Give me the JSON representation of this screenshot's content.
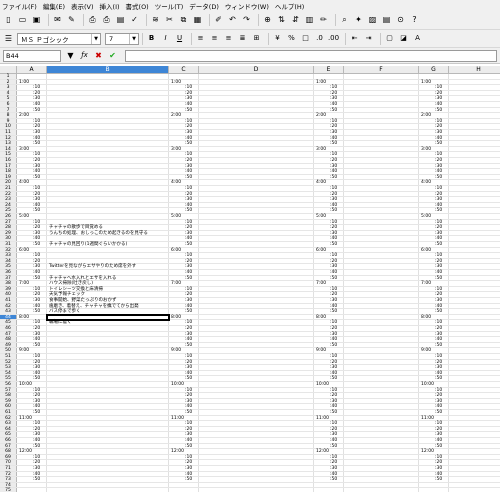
{
  "menu": [
    "ファイル(F)",
    "編集(E)",
    "表示(V)",
    "挿入(I)",
    "書式(O)",
    "ツール(T)",
    "データ(D)",
    "ウィンドウ(W)",
    "ヘルプ(H)"
  ],
  "toolbar1": [
    "new-document-icon",
    "open-icon",
    "save-icon",
    "email-icon",
    "edit-file-icon",
    "export-pdf-icon",
    "print-icon",
    "print-preview-icon",
    "spellcheck-icon",
    "autospell-icon",
    "cut-icon",
    "copy-icon",
    "paste-icon",
    "clone-format-icon",
    "undo-icon",
    "redo-icon",
    "hyperlink-icon",
    "sort-ascending-icon",
    "sort-descending-icon",
    "chart-icon",
    "draw-functions-icon",
    "find-icon",
    "navigator-icon",
    "gallery-icon",
    "data-sources-icon",
    "zoom-icon",
    "help-icon"
  ],
  "toolbar2": {
    "font_name": "ＭＳ Ｐゴシック",
    "font_size": "7",
    "buttons": [
      "bold-icon",
      "italic-icon",
      "underline-icon",
      "align-left-icon",
      "align-center-icon",
      "align-right-icon",
      "justify-icon",
      "merge-cells-icon",
      "currency-icon",
      "percent-icon",
      "standard-format-icon",
      "add-decimal-icon",
      "delete-decimal-icon",
      "decrease-indent-icon",
      "increase-indent-icon",
      "borders-icon",
      "background-color-icon",
      "font-color-icon"
    ]
  },
  "formula_bar": {
    "cell_ref": "B44",
    "value": ""
  },
  "columns": [
    {
      "label": "A",
      "width": 30
    },
    {
      "label": "B",
      "width": 122,
      "active": true
    },
    {
      "label": "C",
      "width": 30
    },
    {
      "label": "D",
      "width": 115
    },
    {
      "label": "E",
      "width": 30
    },
    {
      "label": "F",
      "width": 75
    },
    {
      "label": "G",
      "width": 30
    },
    {
      "label": "H",
      "width": 60
    }
  ],
  "active_row": 44,
  "rows": [
    {
      "n": 1
    },
    {
      "n": 2,
      "a": "1:00",
      "c": "1:00",
      "e": "1:00",
      "g": "1:00"
    },
    {
      "n": 3,
      "a": ":10",
      "c": ":10",
      "e": ":10",
      "g": ":10"
    },
    {
      "n": 4,
      "a": ":20",
      "c": ":20",
      "e": ":20",
      "g": ":20"
    },
    {
      "n": 5,
      "a": ":30",
      "c": ":30",
      "e": ":30",
      "g": ":30"
    },
    {
      "n": 6,
      "a": ":40",
      "c": ":40",
      "e": ":40",
      "g": ":40"
    },
    {
      "n": 7,
      "a": ":50",
      "c": ":50",
      "e": ":50",
      "g": ":50"
    },
    {
      "n": 8,
      "a": "2:00",
      "c": "2:00",
      "e": "2:00",
      "g": "2:00"
    },
    {
      "n": 9,
      "a": ":10",
      "c": ":10",
      "e": ":10",
      "g": ":10"
    },
    {
      "n": 10,
      "a": ":20",
      "c": ":20",
      "e": ":20",
      "g": ":20"
    },
    {
      "n": 11,
      "a": ":30",
      "c": ":30",
      "e": ":30",
      "g": ":30"
    },
    {
      "n": 12,
      "a": ":40",
      "c": ":40",
      "e": ":40",
      "g": ":40"
    },
    {
      "n": 13,
      "a": ":50",
      "c": ":50",
      "e": ":50",
      "g": ":50"
    },
    {
      "n": 14,
      "a": "3:00",
      "c": "3:00",
      "e": "3:00",
      "g": "3:00"
    },
    {
      "n": 15,
      "a": ":10",
      "c": ":10",
      "e": ":10",
      "g": ":10"
    },
    {
      "n": 16,
      "a": ":20",
      "c": ":20",
      "e": ":20",
      "g": ":20"
    },
    {
      "n": 17,
      "a": ":30",
      "c": ":30",
      "e": ":30",
      "g": ":30"
    },
    {
      "n": 18,
      "a": ":40",
      "c": ":40",
      "e": ":40",
      "g": ":40"
    },
    {
      "n": 19,
      "a": ":50",
      "c": ":50",
      "e": ":50",
      "g": ":50"
    },
    {
      "n": 20,
      "a": "4:00",
      "c": "4:00",
      "e": "4:00",
      "g": "4:00"
    },
    {
      "n": 21,
      "a": ":10",
      "c": ":10",
      "e": ":10",
      "g": ":10"
    },
    {
      "n": 22,
      "a": ":20",
      "c": ":20",
      "e": ":20",
      "g": ":20"
    },
    {
      "n": 23,
      "a": ":30",
      "c": ":30",
      "e": ":30",
      "g": ":30"
    },
    {
      "n": 24,
      "a": ":40",
      "c": ":40",
      "e": ":40",
      "g": ":40"
    },
    {
      "n": 25,
      "a": ":50",
      "c": ":50",
      "e": ":50",
      "g": ":50"
    },
    {
      "n": 26,
      "a": "5:00",
      "c": "5:00",
      "e": "5:00",
      "g": "5:00"
    },
    {
      "n": 27,
      "a": ":10",
      "c": ":10",
      "e": ":10",
      "g": ":10"
    },
    {
      "n": 28,
      "a": ":20",
      "b": "チャチャの散歩で目覚める",
      "c": ":20",
      "e": ":20",
      "g": ":20"
    },
    {
      "n": 29,
      "a": ":30",
      "b": "うんちの処理、おしっこのため起きるのを見守る",
      "c": ":30",
      "e": ":30",
      "g": ":30"
    },
    {
      "n": 30,
      "a": ":40",
      "c": ":40",
      "e": ":40",
      "g": ":40"
    },
    {
      "n": 31,
      "a": ":50",
      "b": "チャチャの見回り(1週間ぐらいかかる)",
      "c": ":50",
      "e": ":50",
      "g": ":50"
    },
    {
      "n": 32,
      "a": "6:00",
      "c": "6:00",
      "e": "6:00",
      "g": "6:00"
    },
    {
      "n": 33,
      "a": ":10",
      "c": ":10",
      "e": ":10",
      "g": ":10"
    },
    {
      "n": 34,
      "a": ":20",
      "c": ":20",
      "e": ":20",
      "g": ":20"
    },
    {
      "n": 35,
      "a": ":30",
      "b": "Twitterを見ながらエサやりのため席を外す",
      "c": ":30",
      "e": ":30",
      "g": ":30"
    },
    {
      "n": 36,
      "a": ":40",
      "c": ":40",
      "e": ":40",
      "g": ":40"
    },
    {
      "n": 37,
      "a": ":50",
      "b": "チャチャへ水入れとエサを入れる",
      "c": ":50",
      "e": ":50",
      "g": ":50"
    },
    {
      "n": 38,
      "a": "7:00",
      "b": "ハウス掃除(吐き戻し)",
      "c": "7:00",
      "e": "7:00",
      "g": "7:00"
    },
    {
      "n": 39,
      "a": ":10",
      "b": "トイレシーツ交換と床清掃",
      "c": ":10",
      "e": ":10",
      "g": ":10"
    },
    {
      "n": 40,
      "a": ":20",
      "b": "天気予報チェック",
      "c": ":20",
      "e": ":20",
      "g": ":20"
    },
    {
      "n": 41,
      "a": ":30",
      "b": "食事開始、野菜たっぷりのおかず",
      "c": ":30",
      "e": ":30",
      "g": ":30"
    },
    {
      "n": 42,
      "a": ":40",
      "b": "歯磨き、着替え、チャチャを撫でてから出発",
      "c": ":40",
      "e": ":40",
      "g": ":40"
    },
    {
      "n": 43,
      "a": ":50",
      "b": "バス停まで歩く",
      "c": ":50",
      "e": ":50",
      "g": ":50"
    },
    {
      "n": 44,
      "a": "8:00",
      "c": "8:00",
      "e": "8:00",
      "g": "8:00"
    },
    {
      "n": 45,
      "a": ":10",
      "b": "職場に着く",
      "c": ":10",
      "e": ":10",
      "g": ":10"
    },
    {
      "n": 46,
      "a": ":20",
      "c": ":20",
      "e": ":20",
      "g": ":20"
    },
    {
      "n": 47,
      "a": ":30",
      "c": ":30",
      "e": ":30",
      "g": ":30"
    },
    {
      "n": 48,
      "a": ":40",
      "c": ":40",
      "e": ":40",
      "g": ":40"
    },
    {
      "n": 49,
      "a": ":50",
      "c": ":50",
      "e": ":50",
      "g": ":50"
    },
    {
      "n": 50,
      "a": "9:00",
      "c": "9:00",
      "e": "9:00",
      "g": "9:00"
    },
    {
      "n": 51,
      "a": ":10",
      "c": ":10",
      "e": ":10",
      "g": ":10"
    },
    {
      "n": 52,
      "a": ":20",
      "c": ":20",
      "e": ":20",
      "g": ":20"
    },
    {
      "n": 53,
      "a": ":30",
      "c": ":30",
      "e": ":30",
      "g": ":30"
    },
    {
      "n": 54,
      "a": ":40",
      "c": ":40",
      "e": ":40",
      "g": ":40"
    },
    {
      "n": 55,
      "a": ":50",
      "c": ":50",
      "e": ":50",
      "g": ":50"
    },
    {
      "n": 56,
      "a": "10:00",
      "c": "10:00",
      "e": "10:00",
      "g": "10:00"
    },
    {
      "n": 57,
      "a": ":10",
      "c": ":10",
      "e": ":10",
      "g": ":10"
    },
    {
      "n": 58,
      "a": ":20",
      "c": ":20",
      "e": ":20",
      "g": ":20"
    },
    {
      "n": 59,
      "a": ":30",
      "c": ":30",
      "e": ":30",
      "g": ":30"
    },
    {
      "n": 60,
      "a": ":40",
      "c": ":40",
      "e": ":40",
      "g": ":40"
    },
    {
      "n": 61,
      "a": ":50",
      "c": ":50",
      "e": ":50",
      "g": ":50"
    },
    {
      "n": 62,
      "a": "11:00",
      "c": "11:00",
      "e": "11:00",
      "g": "11:00"
    },
    {
      "n": 63,
      "a": ":10",
      "c": ":10",
      "e": ":10",
      "g": ":10"
    },
    {
      "n": 64,
      "a": ":20",
      "c": ":20",
      "e": ":20",
      "g": ":20"
    },
    {
      "n": 65,
      "a": ":30",
      "c": ":30",
      "e": ":30",
      "g": ":30"
    },
    {
      "n": 66,
      "a": ":40",
      "c": ":40",
      "e": ":40",
      "g": ":40"
    },
    {
      "n": 67,
      "a": ":50",
      "c": ":50",
      "e": ":50",
      "g": ":50"
    },
    {
      "n": 68,
      "a": "12:00",
      "c": "12:00",
      "e": "12:00",
      "g": "12:00"
    },
    {
      "n": 69,
      "a": ":10",
      "c": ":10",
      "e": ":10",
      "g": ":10"
    },
    {
      "n": 70,
      "a": ":20",
      "c": ":20",
      "e": ":20",
      "g": ":20"
    },
    {
      "n": 71,
      "a": ":30",
      "c": ":30",
      "e": ":30",
      "g": ":30"
    },
    {
      "n": 72,
      "a": ":40",
      "c": ":40",
      "e": ":40",
      "g": ":40"
    },
    {
      "n": 73,
      "a": ":50",
      "c": ":50",
      "e": ":50",
      "g": ":50"
    },
    {
      "n": 74
    },
    {
      "n": 75
    }
  ]
}
